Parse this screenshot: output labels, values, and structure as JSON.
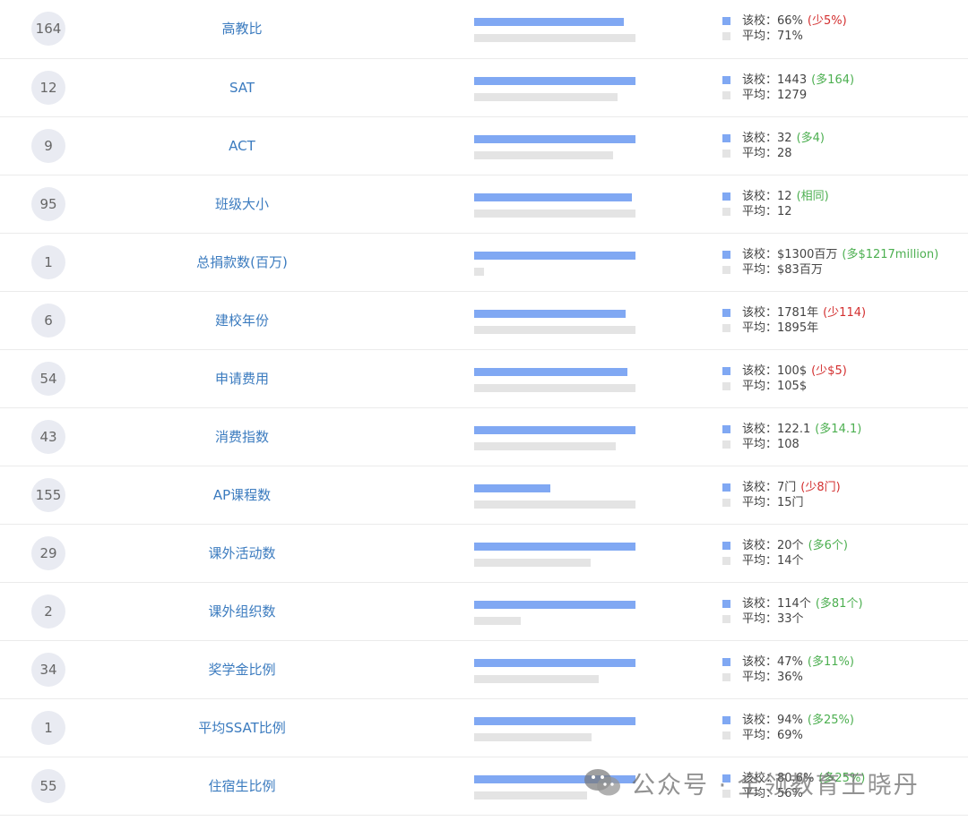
{
  "labels": {
    "school": "该校：",
    "average": "平均："
  },
  "colors": {
    "school_bar": "#80a8f3",
    "average_bar": "#e4e4e4",
    "label_text": "#3b7bbf",
    "more": "#4caf50",
    "less": "#d32f2f"
  },
  "watermark": {
    "text": "公众号 · 全领教育王晓丹",
    "icon": "wechat-icon"
  },
  "rows": [
    {
      "rank": "164",
      "metric": "高教比",
      "school_value": "66%",
      "diff": "(少5%)",
      "diff_type": "down",
      "avg_value": "71%",
      "school_bar": 0.93,
      "avg_bar": 1.0
    },
    {
      "rank": "12",
      "metric": "SAT",
      "school_value": "1443",
      "diff": "(多164)",
      "diff_type": "up",
      "avg_value": "1279",
      "school_bar": 1.0,
      "avg_bar": 0.89
    },
    {
      "rank": "9",
      "metric": "ACT",
      "school_value": "32",
      "diff": "(多4)",
      "diff_type": "up",
      "avg_value": "28",
      "school_bar": 1.0,
      "avg_bar": 0.86
    },
    {
      "rank": "95",
      "metric": "班级大小",
      "school_value": "12",
      "diff": "(相同)",
      "diff_type": "up",
      "avg_value": "12",
      "school_bar": 0.98,
      "avg_bar": 1.0
    },
    {
      "rank": "1",
      "metric": "总捐款数(百万)",
      "school_value": "$1300百万",
      "diff": "(多$1217million)",
      "diff_type": "up",
      "avg_value": "$83百万",
      "school_bar": 1.0,
      "avg_bar": 0.06
    },
    {
      "rank": "6",
      "metric": "建校年份",
      "school_value": "1781年",
      "diff": "(少114)",
      "diff_type": "down",
      "avg_value": "1895年",
      "school_bar": 0.94,
      "avg_bar": 1.0
    },
    {
      "rank": "54",
      "metric": "申请费用",
      "school_value": "100$",
      "diff": "(少$5)",
      "diff_type": "down",
      "avg_value": "105$",
      "school_bar": 0.95,
      "avg_bar": 1.0
    },
    {
      "rank": "43",
      "metric": "消费指数",
      "school_value": "122.1",
      "diff": "(多14.1)",
      "diff_type": "up",
      "avg_value": "108",
      "school_bar": 1.0,
      "avg_bar": 0.88
    },
    {
      "rank": "155",
      "metric": "AP课程数",
      "school_value": "7门",
      "diff": "(少8门)",
      "diff_type": "down",
      "avg_value": "15门",
      "school_bar": 0.47,
      "avg_bar": 1.0
    },
    {
      "rank": "29",
      "metric": "课外活动数",
      "school_value": "20个",
      "diff": "(多6个)",
      "diff_type": "up",
      "avg_value": "14个",
      "school_bar": 1.0,
      "avg_bar": 0.72
    },
    {
      "rank": "2",
      "metric": "课外组织数",
      "school_value": "114个",
      "diff": "(多81个)",
      "diff_type": "up",
      "avg_value": "33个",
      "school_bar": 1.0,
      "avg_bar": 0.29
    },
    {
      "rank": "34",
      "metric": "奖学金比例",
      "school_value": "47%",
      "diff": "(多11%)",
      "diff_type": "up",
      "avg_value": "36%",
      "school_bar": 1.0,
      "avg_bar": 0.77
    },
    {
      "rank": "1",
      "metric": "平均SSAT比例",
      "school_value": "94%",
      "diff": "(多25%)",
      "diff_type": "up",
      "avg_value": "69%",
      "school_bar": 1.0,
      "avg_bar": 0.73
    },
    {
      "rank": "55",
      "metric": "住宿生比例",
      "school_value": "80.6%",
      "diff": "(多25%)",
      "diff_type": "up",
      "avg_value": "56%",
      "school_bar": 1.0,
      "avg_bar": 0.7
    }
  ]
}
